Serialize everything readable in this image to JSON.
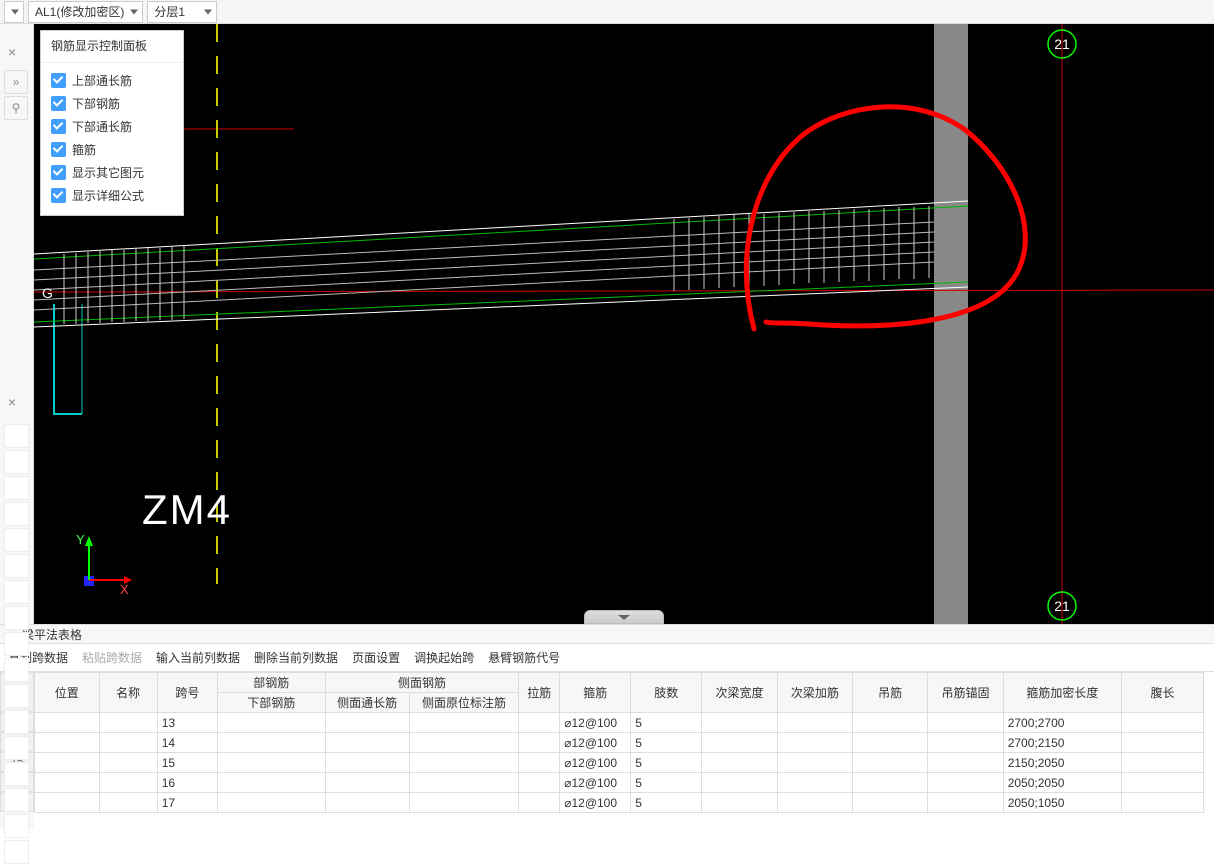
{
  "topbar": {
    "dd1_value": "AL1(修改加密区)",
    "dd2_value": "分层1"
  },
  "panel": {
    "title": "钢筋显示控制面板",
    "items": [
      "上部通长筋",
      "下部钢筋",
      "下部通长筋",
      "箍筋",
      "显示其它图元",
      "显示详细公式"
    ]
  },
  "cad": {
    "label_zm": "ZM4",
    "label_g": "G",
    "bubble_top": "21",
    "bubble_bottom": "21",
    "axis_x": "X",
    "axis_y": "Y"
  },
  "section": {
    "title": "梁平法表格"
  },
  "toolbar": {
    "copy": "复制跨数据",
    "paste": "粘贴跨数据",
    "input": "输入当前列数据",
    "delete": "删除当前列数据",
    "page": "页面设置",
    "swap": "调换起始跨",
    "cant": "悬臂钢筋代号"
  },
  "columns": {
    "pos": "位置",
    "name": "名称",
    "span": "跨号",
    "group_bu": "部钢筋",
    "bottom_bar": "下部钢筋",
    "group_side": "侧面钢筋",
    "side_thru": "侧面通长筋",
    "side_orig": "侧面原位标注筋",
    "tie": "拉筋",
    "stirrup": "箍筋",
    "legs": "肢数",
    "secw": "次梁宽度",
    "secadd": "次梁加筋",
    "hanger": "吊筋",
    "hanchor": "吊筋锚固",
    "stir_dense": "箍筋加密长度",
    "web": "腹长"
  },
  "rows": [
    {
      "row": "13",
      "span": "13",
      "stirrup": "⌀12@100",
      "legs": "5",
      "dense": "2700;2700"
    },
    {
      "row": "14",
      "span": "14",
      "stirrup": "⌀12@100",
      "legs": "5",
      "dense": "2700;2150"
    },
    {
      "row": "15",
      "span": "15",
      "stirrup": "⌀12@100",
      "legs": "5",
      "dense": "2150;2050"
    },
    {
      "row": "16",
      "span": "16",
      "stirrup": "⌀12@100",
      "legs": "5",
      "dense": "2050;2050"
    },
    {
      "row": "17",
      "span": "17",
      "stirrup": "⌀12@100",
      "legs": "5",
      "dense": "2050;1050"
    }
  ]
}
